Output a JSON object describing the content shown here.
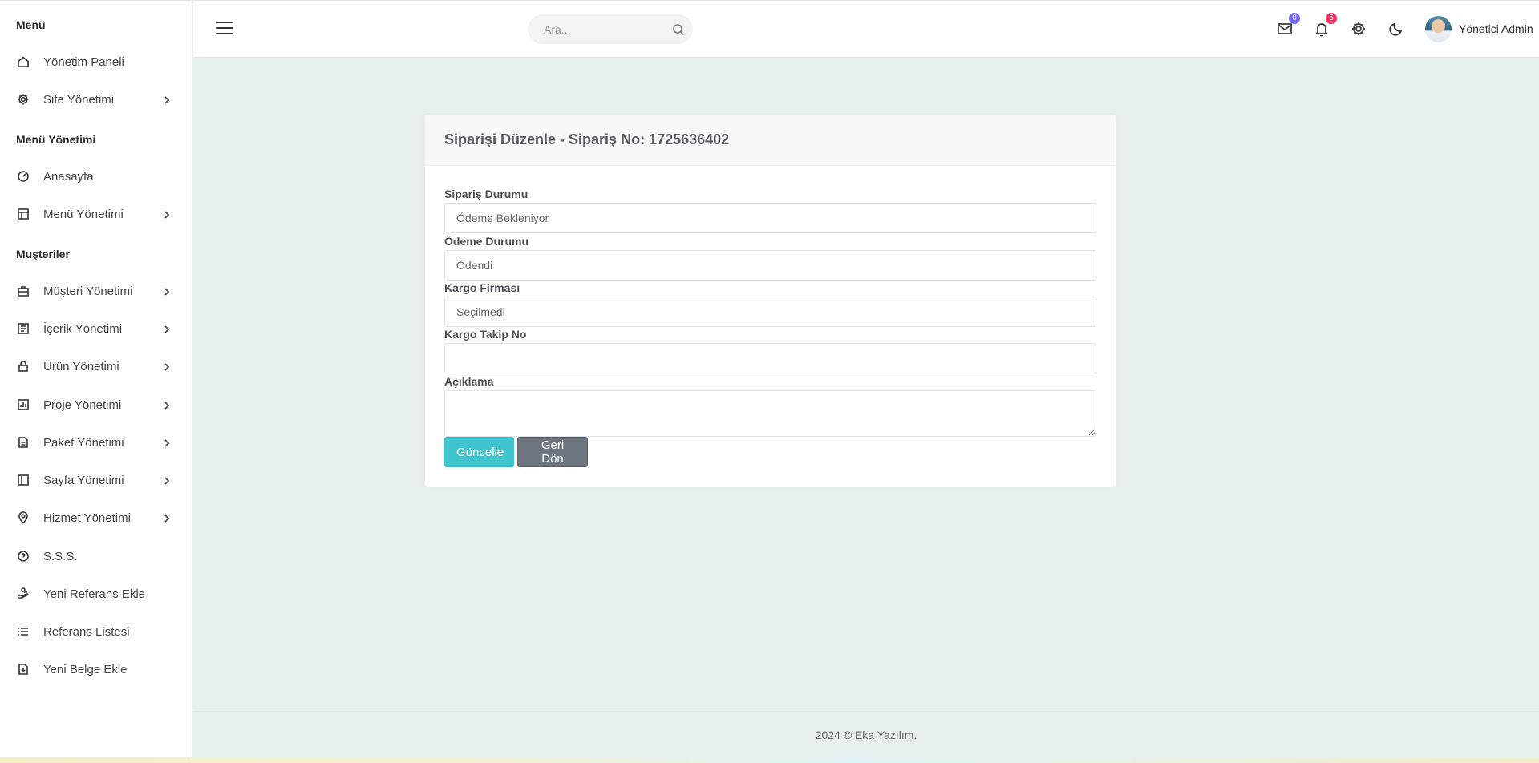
{
  "sidebar": {
    "sections": [
      {
        "title": "Menü"
      },
      {
        "title": "Menü Yönetimi"
      },
      {
        "title": "Muşteriler"
      }
    ],
    "items": [
      {
        "label": "Yönetim Paneli",
        "icon": "home-icon"
      },
      {
        "label": "Site Yönetimi",
        "icon": "gear-icon"
      },
      {
        "label": "Anasayfa",
        "icon": "dashboard-gauge-icon"
      },
      {
        "label": "Menü Yönetimi",
        "icon": "layout-icon"
      },
      {
        "label": "Müşteri Yönetimi",
        "icon": "briefcase-icon"
      },
      {
        "label": "İçerik Yönetimi",
        "icon": "content-list-icon"
      },
      {
        "label": "Ürün Yönetimi",
        "icon": "lock-icon"
      },
      {
        "label": "Proje Yönetimi",
        "icon": "chart-icon"
      },
      {
        "label": "Paket Yönetimi",
        "icon": "document-icon"
      },
      {
        "label": "Sayfa Yönetimi",
        "icon": "sidebar-layout-icon"
      },
      {
        "label": "Hizmet Yönetimi",
        "icon": "location-pin-icon"
      },
      {
        "label": "S.S.S.",
        "icon": "question-icon"
      },
      {
        "label": "Yeni Referans Ekle",
        "icon": "hand-icon"
      },
      {
        "label": "Referans Listesi",
        "icon": "list-icon"
      },
      {
        "label": "Yeni Belge Ekle",
        "icon": "file-add-icon"
      }
    ]
  },
  "header": {
    "search_placeholder": "Ara...",
    "mail_count": "0",
    "notification_count": "5",
    "user_name": "Yönetici Admin"
  },
  "card": {
    "title": "Siparişi Düzenle - Sipariş No: 1725636402",
    "fields": [
      {
        "label": "Sipariş Durumu",
        "value": "Ödeme Bekleniyor"
      },
      {
        "label": "Ödeme Durumu",
        "value": "Ödendi"
      },
      {
        "label": "Kargo Firması",
        "value": "Seçilmedi"
      },
      {
        "label": "Kargo Takip No",
        "value": ""
      },
      {
        "label": "Açıklama",
        "value": ""
      }
    ],
    "update_button": "Güncelle",
    "back_button": "Geri Dön"
  },
  "footer": {
    "text": "2024 © Eka Yazılım."
  },
  "colors": {
    "accent": "#3ec5cf",
    "secondary_button": "#6c757d",
    "badge_mail": "#7366ff",
    "badge_notification": "#f73164",
    "background": "#e8eff1"
  }
}
